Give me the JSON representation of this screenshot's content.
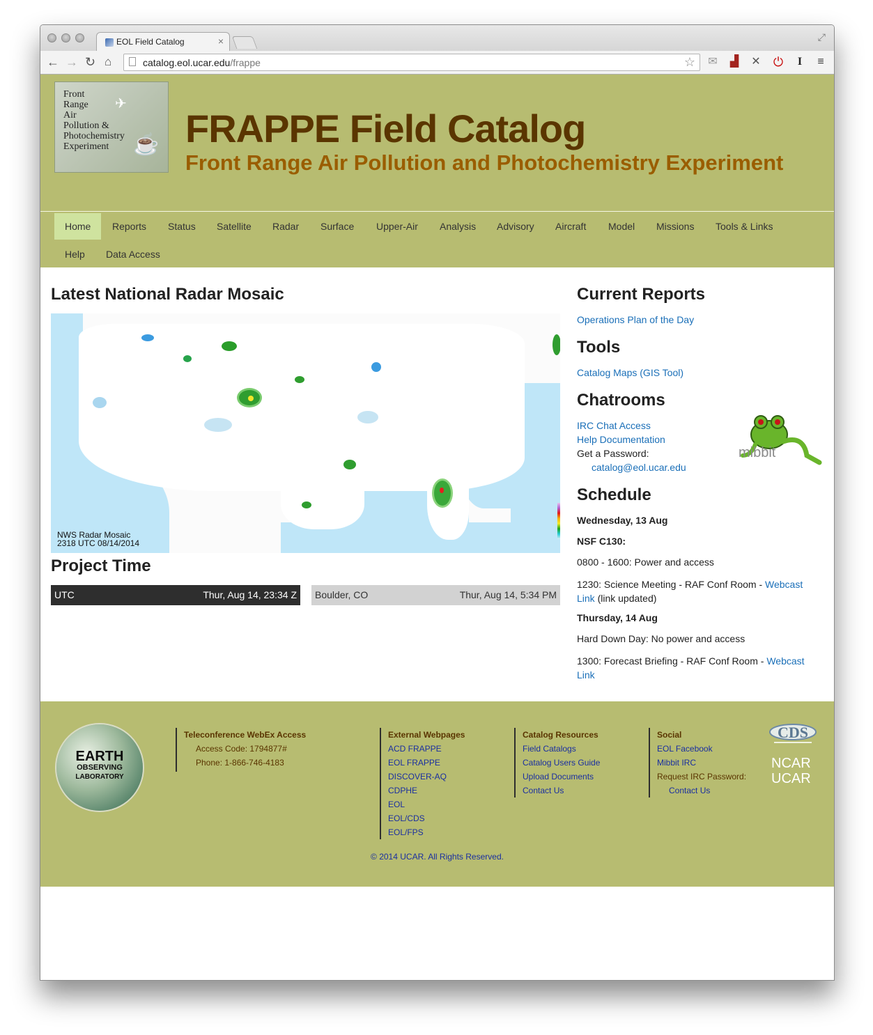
{
  "browser": {
    "tab_title": "EOL Field Catalog",
    "url_host": "catalog.eol.ucar.edu",
    "url_path": "/frappe"
  },
  "header": {
    "logo_text": "Front\nRange\nAir\nPollution &\nPhotochemistry\nExperiment",
    "title": "FRAPPE Field Catalog",
    "subtitle": "Front Range Air Pollution and Photochemistry Experiment"
  },
  "nav": {
    "items": [
      "Home",
      "Reports",
      "Status",
      "Satellite",
      "Radar",
      "Surface",
      "Upper-Air",
      "Analysis",
      "Advisory",
      "Aircraft",
      "Model",
      "Missions",
      "Tools & Links",
      "Help",
      "Data Access"
    ],
    "active": "Home"
  },
  "main": {
    "radar_heading": "Latest National Radar Mosaic",
    "radar_caption_line1": "NWS Radar Mosaic",
    "radar_caption_line2": "2318 UTC 08/14/2014",
    "project_time_heading": "Project Time",
    "utc_label": "UTC",
    "utc_time": "Thur, Aug 14, 23:34 Z",
    "local_label": "Boulder, CO",
    "local_time": "Thur, Aug 14, 5:34 PM"
  },
  "sidebar": {
    "reports_heading": "Current Reports",
    "reports_link": "Operations Plan of the Day",
    "tools_heading": "Tools",
    "tools_link": "Catalog Maps (GIS Tool)",
    "chat_heading": "Chatrooms",
    "chat_link1": "IRC Chat Access",
    "chat_link2": "Help Documentation",
    "chat_password_label": "Get a Password:",
    "chat_email": "catalog@eol.ucar.edu",
    "mibbit_text": "mibbit",
    "schedule_heading": "Schedule",
    "schedule": {
      "day1": "Wednesday, 13 Aug",
      "aircraft": "NSF C130:",
      "item1": "0800 - 1600: Power and access",
      "item2_text": "1230: Science Meeting - RAF Conf Room - ",
      "item2_link_a": "Webcast",
      "item2_link_b": "Link",
      "item2_note": " (link updated)",
      "day2": "Thursday, 14 Aug",
      "item3": "Hard Down Day: No power and access",
      "item4_text": "1300: Forecast Briefing - RAF Conf Room - ",
      "item4_link_a": "Webcast",
      "item4_link_b": "Link"
    }
  },
  "footer": {
    "eol_logo_text1": "EARTH",
    "eol_logo_text2": "OBSERVING",
    "eol_logo_text3": "LABORATORY",
    "webex_heading": "Teleconference WebEx Access",
    "webex_code": "Access Code: 1794877#",
    "webex_phone": "Phone: 1-866-746-4183",
    "external_heading": "External Webpages",
    "external_links": [
      "ACD FRAPPE",
      "EOL FRAPPE",
      "DISCOVER-AQ",
      "CDPHE",
      "EOL",
      "EOL/CDS",
      "EOL/FPS"
    ],
    "catalog_heading": "Catalog Resources",
    "catalog_links": [
      "Field Catalogs",
      "Catalog Users Guide",
      "Upload Documents",
      "Contact Us"
    ],
    "social_heading": "Social",
    "social_link1": "EOL Facebook",
    "social_link2": "Mibbit IRC",
    "social_text": "Request IRC Password:",
    "social_link3": "Contact Us",
    "cds_text": "CDS",
    "ncar_text": "NCAR",
    "ucar_text": "UCAR",
    "copyright": "© 2014 UCAR. All Rights Reserved."
  }
}
